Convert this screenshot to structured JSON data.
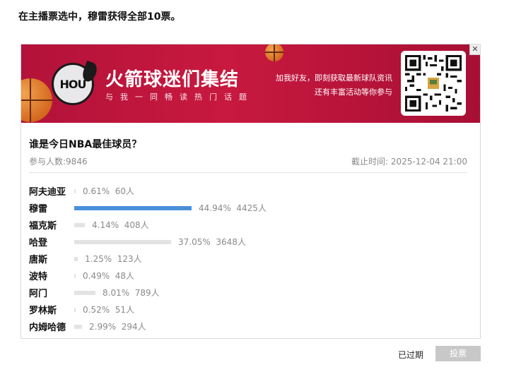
{
  "headline": "在主播票选中，穆雷获得全部10票。",
  "banner": {
    "logo_text": "HOU",
    "title": "火箭球迷们集结",
    "subtitle": "与我一同畅读热门话题",
    "join_line1": "加我好友，即刻获取最新球队资讯",
    "join_line2": "还有丰富活动等你参与",
    "close_glyph": "✕"
  },
  "poll": {
    "question": "谁是今日NBA最佳球员？",
    "participants": "参与人数:9846",
    "deadline": "截止时间: 2025-12-04 21:00",
    "options": [
      {
        "name": "阿夫迪亚",
        "percent": 0.61,
        "percent_text": "0.61%",
        "count_text": "60人"
      },
      {
        "name": "穆雷",
        "percent": 44.94,
        "percent_text": "44.94%",
        "count_text": "4425人"
      },
      {
        "name": "福克斯",
        "percent": 4.14,
        "percent_text": "4.14%",
        "count_text": "408人"
      },
      {
        "name": "哈登",
        "percent": 37.05,
        "percent_text": "37.05%",
        "count_text": "3648人"
      },
      {
        "name": "唐斯",
        "percent": 1.25,
        "percent_text": "1.25%",
        "count_text": "123人"
      },
      {
        "name": "波特",
        "percent": 0.49,
        "percent_text": "0.49%",
        "count_text": "48人"
      },
      {
        "name": "阿门",
        "percent": 8.01,
        "percent_text": "8.01%",
        "count_text": "789人"
      },
      {
        "name": "罗林斯",
        "percent": 0.52,
        "percent_text": "0.52%",
        "count_text": "51人"
      },
      {
        "name": "内姆哈德",
        "percent": 2.99,
        "percent_text": "2.99%",
        "count_text": "294人"
      }
    ]
  },
  "footer": {
    "status": "已过期",
    "vote_label": "投票"
  },
  "colors": {
    "banner": "#c8193f",
    "leading_bar": "#4a8fdc",
    "bar": "#e3e3e3",
    "disabled_button": "#c8c8c8"
  }
}
